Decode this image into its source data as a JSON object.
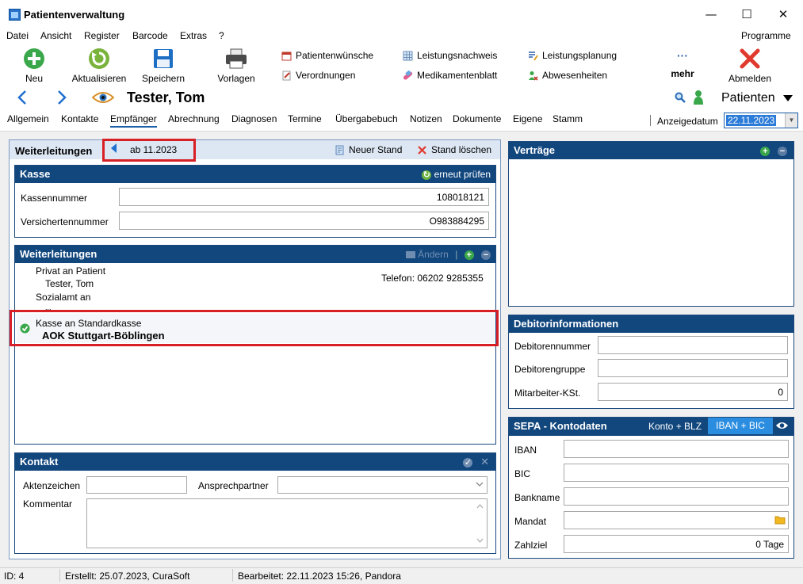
{
  "window": {
    "title": "Patientenverwaltung",
    "minimize": "—",
    "maximize": "☐",
    "close": "✕"
  },
  "menu": {
    "items": [
      "Datei",
      "Ansicht",
      "Register",
      "Barcode",
      "Extras",
      "?"
    ],
    "programme": "Programme"
  },
  "toolbar": {
    "neu": "Neu",
    "aktualisieren": "Aktualisieren",
    "speichern": "Speichern",
    "vorlagen": "Vorlagen",
    "patientenwuensche": "Patientenwünsche",
    "verordnungen": "Verordnungen",
    "leistungsnachweis": "Leistungsnachweis",
    "medikamentenblatt": "Medikamentenblatt",
    "leistungsplanung": "Leistungsplanung",
    "abwesenheiten": "Abwesenheiten",
    "mehr": "mehr",
    "mehr_dots": "···",
    "abmelden": "Abmelden"
  },
  "patient": {
    "name": "Tester, Tom",
    "module": "Patienten"
  },
  "tabs": [
    "Allgemein",
    "Kontakte",
    "Empfänger",
    "Abrechnung",
    "Diagnosen",
    "Termine",
    "Übergabebuch",
    "Notizen",
    "Dokumente",
    "Eigene",
    "Stamm"
  ],
  "anzeige": {
    "label": "Anzeigedatum",
    "value": "22.11.2023"
  },
  "weiterleitungen_top": {
    "title": "Weiterleitungen",
    "stand": "ab 11.2023",
    "neuer_stand": "Neuer Stand",
    "stand_loeschen": "Stand löschen"
  },
  "kasse": {
    "title": "Kasse",
    "erneut_pruefen": "erneut prüfen",
    "kassennummer_label": "Kassennummer",
    "kassennummer": "108018121",
    "versichertennummer_label": "Versichertennummer",
    "versichertennummer": "O983884295"
  },
  "weiterleitungen": {
    "title": "Weiterleitungen",
    "aendern": "Ändern",
    "items": [
      {
        "line1": "Privat an Patient",
        "line2": "Tester, Tom",
        "phone": "Telefon: 06202 9285355"
      },
      {
        "line1": "Sozialamt an",
        "line2": "..."
      },
      {
        "line1": "Kasse an Standardkasse",
        "line2": "AOK Stuttgart-Böblingen"
      }
    ]
  },
  "kontakt": {
    "title": "Kontakt",
    "aktenzeichen": "Aktenzeichen",
    "ansprechpartner": "Ansprechpartner",
    "kommentar": "Kommentar"
  },
  "vertraege": {
    "title": "Verträge"
  },
  "debitor": {
    "title": "Debitorinformationen",
    "nummer": "Debitorennummer",
    "gruppe": "Debitorengruppe",
    "kst": "Mitarbeiter-KSt.",
    "kst_value": "0"
  },
  "sepa": {
    "title": "SEPA - Kontodaten",
    "konto_blz": "Konto + BLZ",
    "iban_bic": "IBAN + BIC",
    "iban": "IBAN",
    "bic": "BIC",
    "bankname": "Bankname",
    "mandat": "Mandat",
    "zahlziel": "Zahlziel",
    "zahlziel_value": "0 Tage"
  },
  "status": {
    "id": "ID: 4",
    "erstellt": "Erstellt: 25.07.2023, CuraSoft",
    "bearbeitet": "Bearbeitet: 22.11.2023 15:26, Pandora"
  },
  "colors": {
    "header": "#12477e",
    "accent": "#2b7bd9",
    "highlight": "#d81f26",
    "green": "#3aa84a"
  }
}
